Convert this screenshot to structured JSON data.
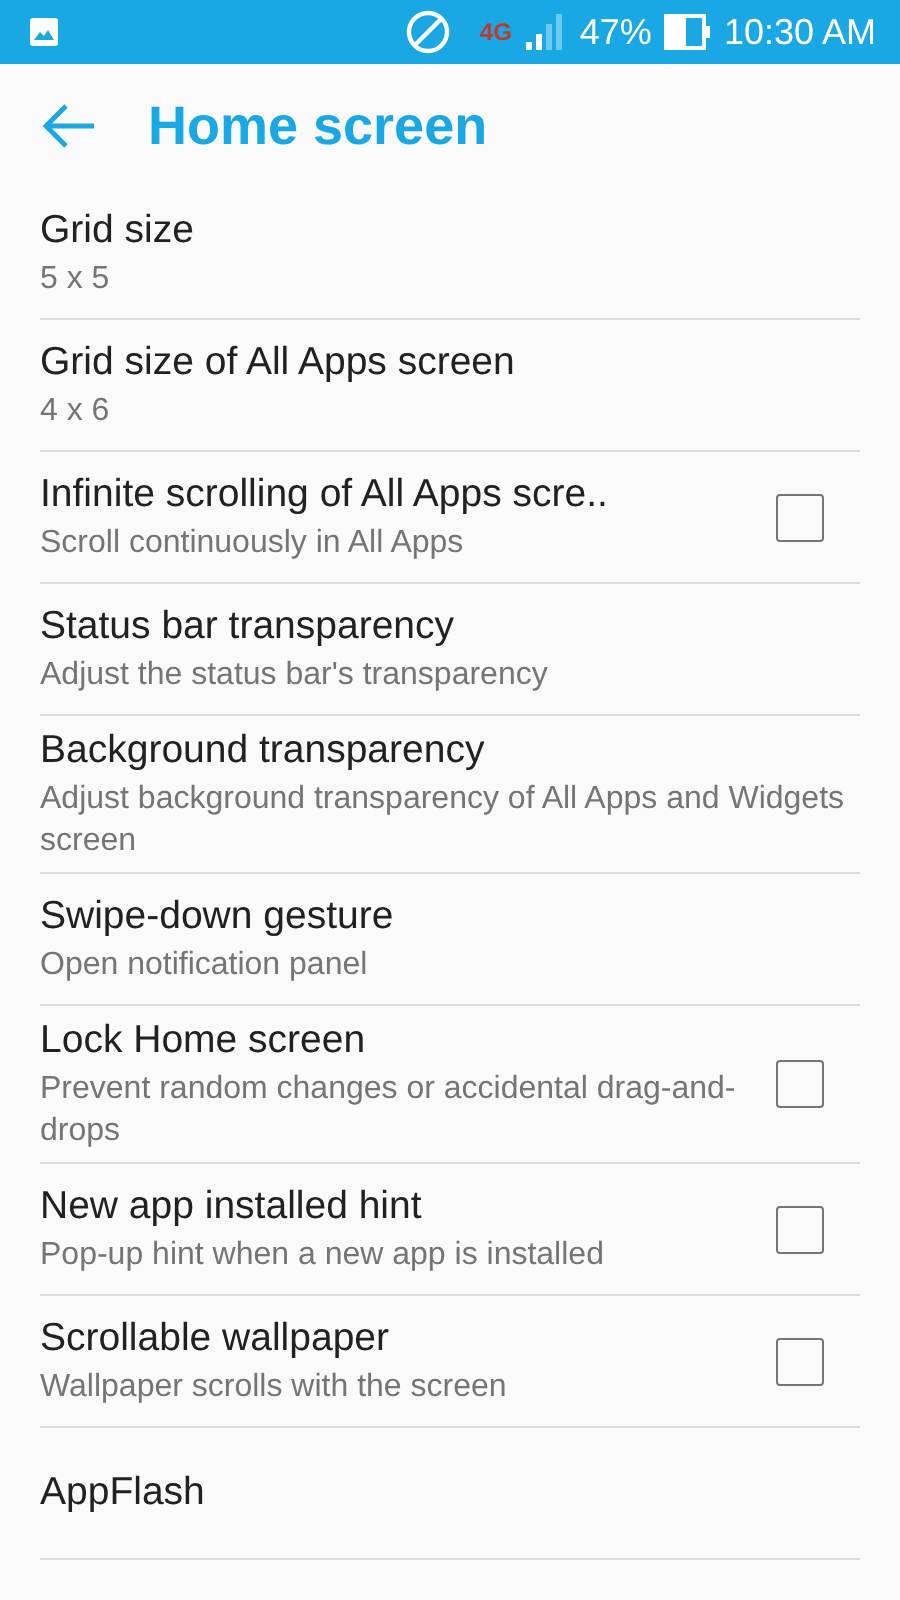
{
  "status_bar": {
    "network": "4G",
    "battery": "47%",
    "time": "10:30 AM"
  },
  "header": {
    "title": "Home screen"
  },
  "settings": [
    {
      "kind": "text",
      "title": "Grid size",
      "subtitle": "5 x 5"
    },
    {
      "kind": "text",
      "title": "Grid size of All Apps screen",
      "subtitle": "4 x 6"
    },
    {
      "kind": "checkbox",
      "title": "Infinite scrolling of All Apps scre..",
      "subtitle": "Scroll continuously in All Apps",
      "checked": false
    },
    {
      "kind": "text",
      "title": "Status bar transparency",
      "subtitle": "Adjust the status bar's transparency"
    },
    {
      "kind": "text",
      "title": "Background transparency",
      "subtitle": "Adjust background transparency of All Apps and Widgets screen"
    },
    {
      "kind": "text",
      "title": "Swipe-down gesture",
      "subtitle": "Open notification panel"
    },
    {
      "kind": "checkbox",
      "title": "Lock Home screen",
      "subtitle": "Prevent random changes or accidental drag-and-drops",
      "checked": false
    },
    {
      "kind": "checkbox",
      "title": "New app installed hint",
      "subtitle": "Pop-up hint when a new app is installed",
      "checked": false
    },
    {
      "kind": "checkbox",
      "title": "Scrollable wallpaper",
      "subtitle": "Wallpaper scrolls with the screen",
      "checked": false
    },
    {
      "kind": "text",
      "title": "AppFlash"
    }
  ]
}
